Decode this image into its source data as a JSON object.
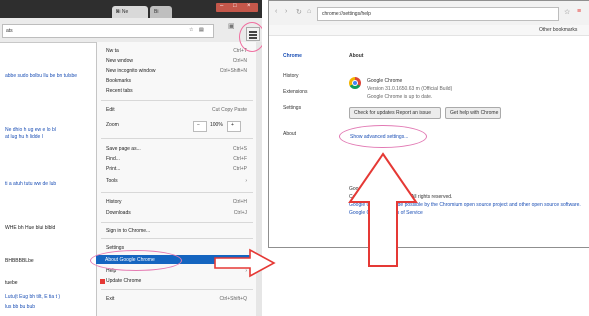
{
  "left": {
    "tabs": [
      {
        "label": "Bi Ne"
      },
      {
        "label": "Bi"
      }
    ],
    "close_glyph": "×",
    "window_buttons": [
      "–",
      "□",
      "×"
    ],
    "address_text": "ats",
    "menu_glyph": "menu-icon",
    "page_lines": [
      "abbe sudo bolbu llu be bn tulsbe",
      "Ne dhio h ug ew e lo bl",
      "at lug hu h lidde l",
      "ti a atuh tutu ww de lub",
      "WHE bh Hue blui blbld",
      "BHBBBBLbe",
      "tuebe",
      "Lutu(t Eug bh tilt, E tia t )",
      "lus bb bu bub"
    ],
    "menu_items": [
      {
        "label": "Nw ta",
        "shortcut": "Ctrl+T"
      },
      {
        "label": "New wndow",
        "shortcut": "Ctrl+N"
      },
      {
        "label": "New incognito window",
        "shortcut": "Ctrl+Shift+N"
      },
      {
        "label": "Bookmarks",
        "shortcut": ""
      },
      {
        "label": "Recent tabs",
        "shortcut": ""
      },
      {
        "label": "Edit",
        "shortcut": "Cut   Copy   Paste"
      },
      {
        "label": "Zoom",
        "shortcut": ""
      },
      {
        "label": "Save page as...",
        "shortcut": "Ctrl+S"
      },
      {
        "label": "Find...",
        "shortcut": "Ctrl+F"
      },
      {
        "label": "Print...",
        "shortcut": "Ctrl+P"
      },
      {
        "label": "Tools",
        "shortcut": ""
      },
      {
        "label": "History",
        "shortcut": "Ctrl+H"
      },
      {
        "label": "Downloads",
        "shortcut": "Ctrl+J"
      },
      {
        "label": "Sign in to Chrome...",
        "shortcut": ""
      },
      {
        "label": "Settings",
        "shortcut": ""
      },
      {
        "label": "About Google Chrome",
        "shortcut": ""
      },
      {
        "label": "Help",
        "shortcut": ""
      },
      {
        "label": "Update Chrome",
        "shortcut": ""
      },
      {
        "label": "Exit",
        "shortcut": "Ctrl+Shift+Q"
      }
    ],
    "zoom_controls": [
      "−",
      "100%",
      "+"
    ],
    "highlight_color": "#1565c0",
    "annotation_color": "#e47ab1"
  },
  "right": {
    "address_text": "chrome://settings/help",
    "bookmarks_text": "Other bookmarks",
    "sidebar": [
      "Chrome",
      "History",
      "Extensions",
      "Settings",
      "About"
    ],
    "heading": "About",
    "product_name": "Google Chrome",
    "version_text": "Version 31.0.1650.63 m (Official Build)",
    "update_status": "Google Chrome is up to date.",
    "buttons": [
      "Check for updates  Report an issue",
      "Get help with Chrome"
    ],
    "show_link": "Show advanced settings...",
    "footer_lines": [
      "Google Chrome",
      "Copyright 2013 Google Inc. All rights reserved.",
      "Google Chrome is made possible by the Chromium open source project and other open source software.",
      "Google Chrome Terms of Service"
    ],
    "arrow_color": "#e53935"
  }
}
